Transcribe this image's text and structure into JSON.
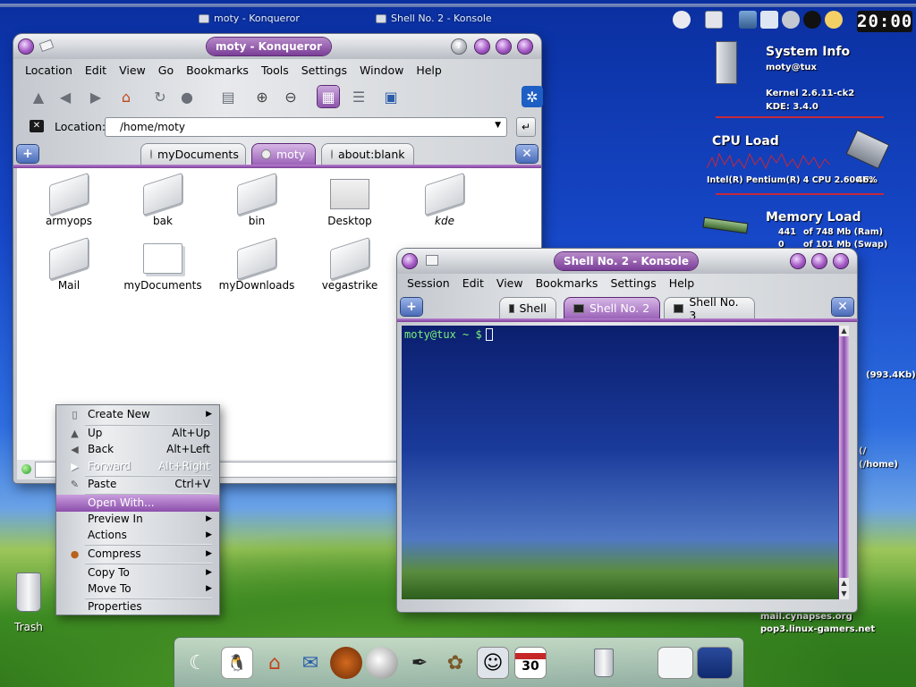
{
  "top_panel": {
    "tasks": [
      {
        "label": "moty - Konqueror"
      },
      {
        "label": "Shell No. 2 - Konsole"
      }
    ],
    "clock": "20:00"
  },
  "konqueror": {
    "title": "moty - Konqueror",
    "menu": [
      "Location",
      "Edit",
      "View",
      "Go",
      "Bookmarks",
      "Tools",
      "Settings",
      "Window",
      "Help"
    ],
    "location_label": "Location:",
    "location_value": "/home/moty",
    "tabs": [
      "myDocuments",
      "moty",
      "about:blank"
    ],
    "files": [
      {
        "name": "armyops",
        "type": "folder"
      },
      {
        "name": "bak",
        "type": "folder"
      },
      {
        "name": "bin",
        "type": "folder"
      },
      {
        "name": "Desktop",
        "type": "desktop"
      },
      {
        "name": "kde",
        "type": "link"
      },
      {
        "name": "Mail",
        "type": "folder"
      },
      {
        "name": "myDocuments",
        "type": "doc"
      },
      {
        "name": "myDownloads",
        "type": "folder"
      },
      {
        "name": "vegastrike",
        "type": "folder"
      }
    ]
  },
  "konsole": {
    "title": "Shell No. 2 - Konsole",
    "menu": [
      "Session",
      "Edit",
      "View",
      "Bookmarks",
      "Settings",
      "Help"
    ],
    "tabs": [
      "Shell",
      "Shell No. 2",
      "Shell No. 3"
    ],
    "prompt": "moty@tux ~ $"
  },
  "context_menu": {
    "items": [
      {
        "label": "Create New",
        "submenu": true
      },
      {
        "label": "Up",
        "accel": "Alt+Up"
      },
      {
        "label": "Back",
        "accel": "Alt+Left"
      },
      {
        "label": "Forward",
        "accel": "Alt+Right",
        "disabled": true
      },
      {
        "label": "Paste",
        "accel": "Ctrl+V"
      },
      {
        "label": "Open With...",
        "highlighted": true
      },
      {
        "label": "Preview In",
        "submenu": true
      },
      {
        "label": "Actions",
        "submenu": true
      },
      {
        "label": "Compress",
        "submenu": true
      },
      {
        "label": "Copy To",
        "submenu": true
      },
      {
        "label": "Move To",
        "submenu": true
      },
      {
        "label": "Properties"
      }
    ]
  },
  "system_info": {
    "title": "System Info",
    "user": "moty@tux",
    "kernel": "Kernel 2.6.11-ck2",
    "kde": "KDE: 3.4.0",
    "cpu_title": "CPU Load",
    "cpu_model": "Intel(R) Pentium(R) 4 CPU 2.60GHz",
    "cpu_percent": "46%",
    "memory_title": "Memory Load",
    "ram_used": "441",
    "ram_text": "of 748 Mb (Ram)",
    "swap_used": "0",
    "swap_text": "of 101 Mb (Swap)",
    "net_text": "(993.4Kb)",
    "disk_path": "(/home)",
    "disk_root": "(/",
    "mail1": "mail.cynapses.org",
    "mail2": "pop3.linux-gamers.net"
  },
  "desktop": {
    "trash_label": "Trash"
  },
  "bottom_panel": {
    "calendar_day": "30"
  },
  "colors": {
    "accent": "#8c4fac",
    "terminal_prompt": "#7af27a"
  }
}
